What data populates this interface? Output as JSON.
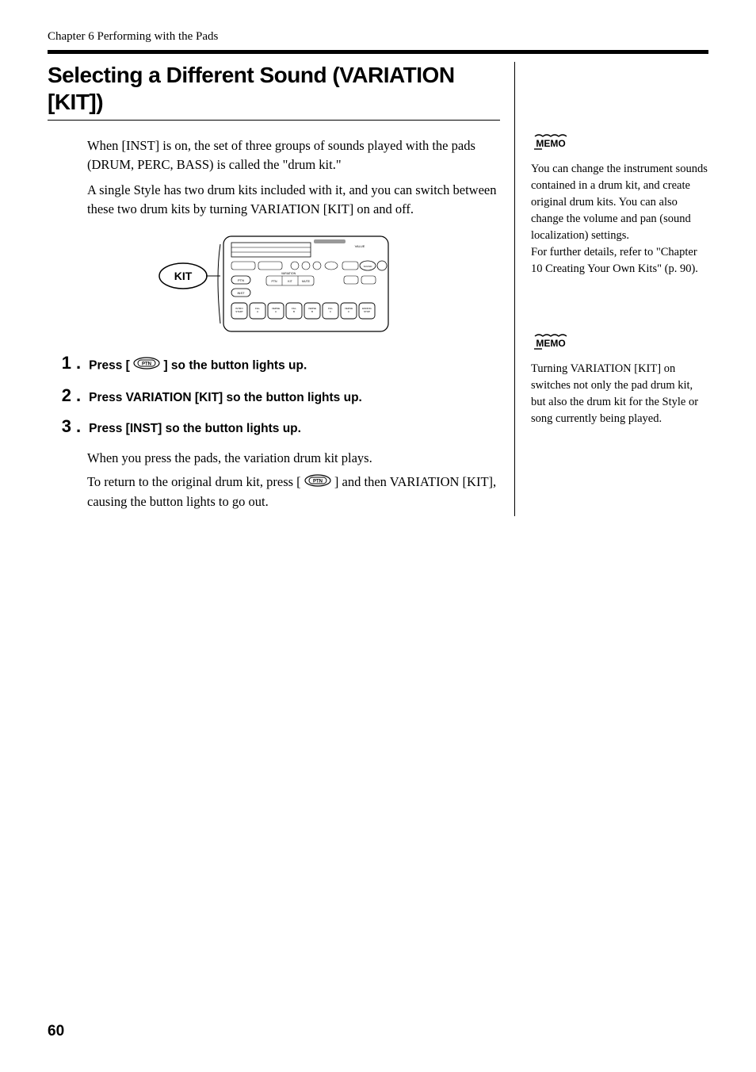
{
  "chapter_header": "Chapter 6 Performing with the Pads",
  "section_title": "Selecting a Different Sound (VARIATION [KIT])",
  "intro_para_1": "When [INST] is on, the set of three groups of sounds played with the pads (DRUM, PERC, BASS) is called the \"drum kit.\"",
  "intro_para_2": "A single Style has two drum kits included with it, and you can switch between these two drum kits by turning VARIATION [KIT] on and off.",
  "figure": {
    "kit_label": "KIT"
  },
  "steps": [
    {
      "num": "1",
      "label_pre": "Press [",
      "label_post": "] so the button lights up.",
      "has_icon": true
    },
    {
      "num": "2",
      "label": "Press VARIATION [KIT] so the button lights up."
    },
    {
      "num": "3",
      "label": "Press [INST] so the button lights up.",
      "sub1": "When you press the pads, the variation drum kit plays.",
      "sub2_pre": "To return to the original drum kit, press [",
      "sub2_post": "] and then VARIATION [KIT], causing the button lights to go out."
    }
  ],
  "memo1": {
    "title": "MEMO",
    "text1": "You can change the instrument sounds contained in a drum kit, and create original drum kits. You can also change the volume and pan (sound localization) settings.",
    "text2": "For further details, refer to \"Chapter 10 Creating Your Own Kits\" (p. 90)."
  },
  "memo2": {
    "title": "MEMO",
    "text": "Turning VARIATION [KIT] on switches not only the pad drum kit, but also the drum kit for the Style or song currently being played."
  },
  "page_number": "60"
}
